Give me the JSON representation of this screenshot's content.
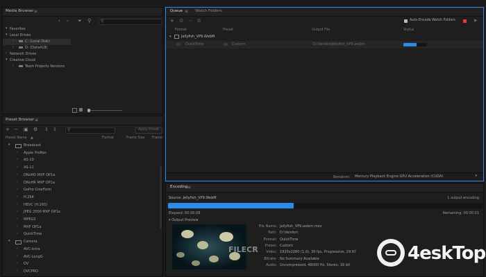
{
  "media_browser": {
    "title": "Media Browser",
    "tree": [
      "Favorites",
      "Local Drives",
      "C: (Local Disk)",
      "D: (Data418)",
      "Network Drives",
      "Creative Cloud",
      "Team Projects Versions"
    ]
  },
  "preset_browser": {
    "title": "Preset Browser",
    "columns": [
      "Preset Name",
      "Format",
      "Frame Size",
      "Frame"
    ],
    "apply_label": "Apply Preset",
    "items": [
      {
        "label": "Broadcast",
        "level": 0,
        "open": true
      },
      {
        "label": "Apple ProRes",
        "level": 1
      },
      {
        "label": "AS-10",
        "level": 1
      },
      {
        "label": "AS-11",
        "level": 1
      },
      {
        "label": "DNxHD MXF OP1a",
        "level": 1
      },
      {
        "label": "DNxHR MXF OP1a",
        "level": 1
      },
      {
        "label": "GoPro CineForm",
        "level": 1
      },
      {
        "label": "H.264",
        "level": 1
      },
      {
        "label": "HEVC (H.265)",
        "level": 1
      },
      {
        "label": "JPEG 2000 MXF OP1a",
        "level": 1
      },
      {
        "label": "MPEG2",
        "level": 1
      },
      {
        "label": "MXF OP1a",
        "level": 1
      },
      {
        "label": "QuickTime",
        "level": 1
      },
      {
        "label": "Camera",
        "level": 0,
        "open": true
      },
      {
        "label": "AVC-Intra",
        "level": 1
      },
      {
        "label": "AVC-LongG",
        "level": 1
      },
      {
        "label": "DV",
        "level": 1
      },
      {
        "label": "DVCPRO",
        "level": 1
      }
    ]
  },
  "queue": {
    "tabs": [
      "Queue",
      "Watch Folders"
    ],
    "auto_encode_label": "Auto-Encode Watch Folders",
    "columns": [
      "Format",
      "Preset",
      "Output File",
      "Status"
    ],
    "group_label": "Jellyfish_VP9.WebM",
    "job": {
      "format": "QuickTime",
      "preset": "Custom",
      "output": "D:\\Vendor\\Jellyfish_VP9.webm",
      "progress": 0.55
    },
    "renderer_label": "Renderer:",
    "renderer_value": "Mercury Playback Engine GPU Acceleration (CUDA)"
  },
  "encoding": {
    "title": "Encoding",
    "source": "Source: Jellyfish_VP9.WebM",
    "outputs": "1 output encoding",
    "elapsed": "Elapsed: 00:00:08",
    "remaining": "Remaining: 00:00:01",
    "progress": 0.4,
    "output_preview": "Output Preview",
    "meta": [
      {
        "k": "File Name:",
        "v": "Jellyfish_VP9.webm.mov"
      },
      {
        "k": "Path:",
        "v": "D:\\Vendor\\"
      },
      {
        "k": "Format:",
        "v": "QuickTime"
      },
      {
        "k": "Preset:",
        "v": "Custom"
      },
      {
        "k": "Video:",
        "v": "1920x1080 (1.0), 30 fps, Progressive, 29.97"
      },
      {
        "k": "Bitrate:",
        "v": "No Summary Available"
      },
      {
        "k": "Audio:",
        "v": "Uncompressed, 48000 Hz, Stereo, 16 bit"
      }
    ]
  },
  "watermark": {
    "brand": "4eskTop",
    "site": "FILECR"
  },
  "colors": {
    "accent": "#2d8ceb",
    "record": "#e23b3b"
  }
}
